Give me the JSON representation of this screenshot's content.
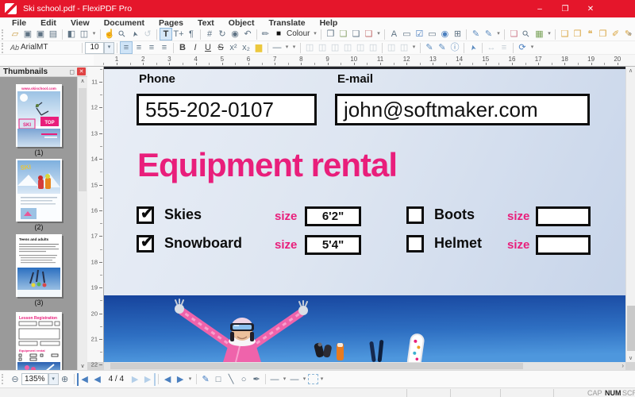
{
  "window": {
    "title": "Ski school.pdf - FlexiPDF Pro",
    "minimize": "–",
    "maximize": "❐",
    "close": "✕"
  },
  "menu": [
    "File",
    "Edit",
    "View",
    "Document",
    "Pages",
    "Text",
    "Object",
    "Translate",
    "Help"
  ],
  "strips": {
    "main": [
      [
        {
          "name": "open-file-icon",
          "glyph": "▱",
          "cls": "c-folder"
        },
        {
          "name": "save-icon",
          "glyph": "▣"
        },
        {
          "name": "save-as-icon",
          "glyph": "▣"
        },
        {
          "name": "print-icon",
          "glyph": "▤"
        }
      ],
      [
        {
          "name": "single-page-view-icon",
          "glyph": "◧"
        },
        {
          "name": "facing-pages-view-icon",
          "glyph": "◫"
        },
        {
          "name": "view-menu-caret",
          "glyph": "▾",
          "cls": "caret"
        }
      ],
      [
        {
          "name": "hand-tool-icon",
          "glyph": "☝"
        },
        {
          "name": "zoom-tool-icon",
          "glyph": "⚲",
          "cls": "rot"
        },
        {
          "name": "select-tool-icon",
          "glyph": "➤",
          "cls": "rot2"
        },
        {
          "name": "rotate-view-icon",
          "glyph": "↺",
          "cls": "c-dis"
        }
      ],
      [
        {
          "name": "edit-text-icon",
          "glyph": "T",
          "cls": "c-active"
        },
        {
          "name": "add-text-icon",
          "glyph": "T+"
        },
        {
          "name": "text-tool-icon",
          "glyph": "¶"
        }
      ],
      [
        {
          "name": "crop-icon",
          "glyph": "#"
        },
        {
          "name": "rotate-object-icon",
          "glyph": "↻"
        },
        {
          "name": "snapshot-icon",
          "glyph": "◉"
        },
        {
          "name": "revert-icon",
          "glyph": "↶"
        }
      ],
      [
        {
          "name": "eyedropper-icon",
          "glyph": "✎",
          "cls": "rot"
        },
        {
          "name": "colour-swatch-icon",
          "glyph": "■",
          "cls": "c-black"
        },
        {
          "name": "colour-label",
          "text": "Colour",
          "cls": "lbl",
          "ro": true
        },
        {
          "name": "colour-caret",
          "glyph": "▾",
          "cls": "caret"
        }
      ],
      [
        {
          "name": "extract-page-icon",
          "glyph": "❐"
        },
        {
          "name": "insert-page-icon",
          "glyph": "❏",
          "cls": "c-plus"
        },
        {
          "name": "edit-page-icon",
          "glyph": "❏"
        },
        {
          "name": "delete-page-icon",
          "glyph": "❏",
          "cls": "c-del"
        },
        {
          "name": "pages-caret",
          "glyph": "▾",
          "cls": "caret"
        }
      ],
      [
        {
          "name": "form-text-field-icon",
          "glyph": "A"
        },
        {
          "name": "form-button-icon",
          "glyph": "▭"
        },
        {
          "name": "form-checkbox-icon",
          "glyph": "☑",
          "cls": "c-blue"
        },
        {
          "name": "form-field-icon",
          "glyph": "▭"
        },
        {
          "name": "form-radio-icon",
          "glyph": "◉",
          "cls": "c-blue"
        },
        {
          "name": "form-combo-icon",
          "glyph": "⊞"
        }
      ],
      [
        {
          "name": "edit-form-icon",
          "glyph": "✎",
          "cls": "c-blue2"
        },
        {
          "name": "form-properties-icon",
          "glyph": "✎",
          "cls": "c-blue2"
        },
        {
          "name": "form-caret",
          "glyph": "▾",
          "cls": "caret"
        }
      ],
      [
        {
          "name": "preflight-icon",
          "glyph": "❏",
          "cls": "c-pink"
        },
        {
          "name": "find-icon",
          "glyph": "⚲",
          "cls": "rot"
        },
        {
          "name": "insert-image-icon",
          "glyph": "▦",
          "cls": "c-img"
        },
        {
          "name": "media-caret",
          "glyph": "▾",
          "cls": "caret"
        }
      ],
      [
        {
          "name": "note-icon",
          "glyph": "❑",
          "cls": "c-note"
        },
        {
          "name": "text-note-icon",
          "glyph": "❒",
          "cls": "c-note"
        },
        {
          "name": "comment-icon",
          "glyph": "❝",
          "cls": "c-note"
        },
        {
          "name": "stamp-icon",
          "glyph": "❐",
          "cls": "c-note"
        },
        {
          "name": "highlight-note-icon",
          "glyph": "✐",
          "cls": "c-note"
        },
        {
          "name": "strike-note-icon",
          "glyph": "✎",
          "cls": "c-note"
        }
      ]
    ],
    "format": [
      [
        {
          "name": "font-style-icon",
          "glyph": "Ab",
          "cls": "ab"
        },
        {
          "name": "font-name-value",
          "text": "ArialMT",
          "cls": "fname"
        }
      ],
      [
        {
          "name": "font-size-value",
          "text": "10",
          "cls": "box"
        },
        {
          "name": "font-size-caret",
          "glyph": "▾",
          "cls": "caretbox"
        }
      ],
      [
        {
          "name": "align-left-icon",
          "glyph": "≡",
          "cls": "c-sel"
        },
        {
          "name": "align-center-icon",
          "glyph": "≡"
        },
        {
          "name": "align-right-icon",
          "glyph": "≡"
        },
        {
          "name": "align-justify-icon",
          "glyph": "≡"
        }
      ],
      [
        {
          "name": "bold-icon",
          "glyph": "B",
          "cls": "bold"
        },
        {
          "name": "italic-icon",
          "glyph": "I",
          "cls": "ital"
        },
        {
          "name": "underline-icon",
          "glyph": "U",
          "cls": "und"
        },
        {
          "name": "strikethrough-icon",
          "glyph": "S",
          "cls": "strk"
        },
        {
          "name": "superscript-icon",
          "glyph": "x²"
        },
        {
          "name": "subscript-icon",
          "glyph": "x₂"
        },
        {
          "name": "highlight-colour-icon",
          "glyph": "▆",
          "cls": "c-hl"
        }
      ],
      [
        {
          "name": "line-style-icon",
          "glyph": "—"
        },
        {
          "name": "line-style-caret",
          "glyph": "▾",
          "cls": "caret"
        },
        {
          "name": "more-format-caret",
          "glyph": "▾",
          "cls": "caret"
        }
      ],
      [
        {
          "name": "align-objects-left-icon",
          "glyph": "◫",
          "cls": "c-dis"
        },
        {
          "name": "align-objects-center-icon",
          "glyph": "◫",
          "cls": "c-dis"
        },
        {
          "name": "align-objects-right-icon",
          "glyph": "◫",
          "cls": "c-dis"
        },
        {
          "name": "align-objects-top-icon",
          "glyph": "◫",
          "cls": "c-dis"
        },
        {
          "name": "align-objects-middle-icon",
          "glyph": "◫",
          "cls": "c-dis"
        },
        {
          "name": "align-objects-bottom-icon",
          "glyph": "◫",
          "cls": "c-dis"
        }
      ],
      [
        {
          "name": "distribute-h-icon",
          "glyph": "◫",
          "cls": "c-dis"
        },
        {
          "name": "distribute-v-icon",
          "glyph": "◫",
          "cls": "c-dis"
        },
        {
          "name": "arrange-caret",
          "glyph": "▾",
          "cls": "caret"
        }
      ],
      [
        {
          "name": "edit-object-icon",
          "glyph": "✎",
          "cls": "c-blue2"
        },
        {
          "name": "object-properties-icon",
          "glyph": "✎",
          "cls": "c-blue2"
        },
        {
          "name": "object-info-icon",
          "glyph": "ⓘ",
          "cls": "c-blue2"
        }
      ],
      [
        {
          "name": "pointer-icon",
          "glyph": "➤",
          "cls": "rot2 c-blue2"
        }
      ],
      [
        {
          "name": "flip-icon",
          "glyph": "↔",
          "cls": "c-dis"
        },
        {
          "name": "layers-icon",
          "glyph": "≡",
          "cls": "c-dis"
        }
      ],
      [
        {
          "name": "translate-sync-icon",
          "glyph": "⟳",
          "cls": "c-blue"
        },
        {
          "name": "translate-caret",
          "glyph": "▾",
          "cls": "caret"
        }
      ]
    ],
    "bottom": [
      [
        {
          "name": "zoom-out-icon",
          "glyph": "⊖"
        },
        {
          "name": "zoom-level-value",
          "text": "135%",
          "cls": "box"
        },
        {
          "name": "zoom-caret",
          "glyph": "▾",
          "cls": "caretbox"
        },
        {
          "name": "zoom-in-icon",
          "glyph": "⊕"
        }
      ],
      [
        {
          "name": "first-page-icon",
          "glyph": "◀",
          "cls": "c-blue barl"
        },
        {
          "name": "prev-page-icon",
          "glyph": "◀",
          "cls": "c-blue"
        },
        {
          "name": "page-indicator",
          "text": "4 / 4",
          "cls": "plabel",
          "ro": true
        },
        {
          "name": "next-page-icon",
          "glyph": "▶",
          "cls": "c-pale"
        },
        {
          "name": "last-page-icon",
          "glyph": "▶",
          "cls": "c-pale barr"
        }
      ],
      [
        {
          "name": "nav-back-icon",
          "glyph": "◀",
          "cls": "c-blue"
        },
        {
          "name": "nav-forward-icon",
          "glyph": "▶",
          "cls": "c-blue"
        },
        {
          "name": "nav-caret",
          "glyph": "▾",
          "cls": "caret"
        }
      ],
      [
        {
          "name": "pencil-tool-icon",
          "glyph": "✎",
          "cls": "c-pen"
        },
        {
          "name": "rectangle-tool-icon",
          "glyph": "□"
        },
        {
          "name": "line-tool-icon",
          "glyph": "╲"
        },
        {
          "name": "ellipse-tool-icon",
          "glyph": "○"
        },
        {
          "name": "pen-tool-icon",
          "glyph": "✒"
        }
      ],
      [
        {
          "name": "stroke-style-icon",
          "glyph": "—"
        },
        {
          "name": "stroke-style-caret",
          "glyph": "▾",
          "cls": "caret"
        },
        {
          "name": "stroke-width-icon",
          "glyph": "—"
        },
        {
          "name": "stroke-width-caret",
          "glyph": "▾",
          "cls": "caret"
        },
        {
          "name": "select-frame-icon",
          "glyph": "",
          "cls": "dashed"
        },
        {
          "name": "draw-tools-caret",
          "glyph": "▾",
          "cls": "caret"
        }
      ]
    ]
  },
  "toolbar_overflow": "»",
  "rulers": {
    "horizontal": [
      "1",
      "2",
      "3",
      "4",
      "5",
      "6",
      "7",
      "8",
      "9",
      "10",
      "11",
      "12",
      "13",
      "14",
      "15",
      "16",
      "17",
      "18",
      "19",
      "20"
    ],
    "vertical": [
      "11",
      "12",
      "13",
      "14",
      "15",
      "16",
      "17",
      "18",
      "19",
      "20",
      "21",
      "22"
    ]
  },
  "thumbnails": {
    "panel_title": "Thumbnails",
    "page1_label": "(1)",
    "page2_label": "(2)",
    "page3_label": "(3)",
    "page1_texts": {
      "url": "www.skischool.com",
      "badge": "TOP",
      "ski": "SKI"
    },
    "page2_texts": {
      "ski": "SKI"
    },
    "page3_texts": {
      "title": "Teens and adults"
    },
    "page4_texts": {
      "title": "Lesson  Registration",
      "heading": "Equipment rental"
    }
  },
  "document": {
    "phone_label": "Phone",
    "phone_value": "555-202-0107",
    "email_label": "E-mail",
    "email_value": "john@softmaker.com",
    "heading": "Equipment rental",
    "fields": [
      {
        "label": "Skies",
        "checked": true,
        "size_label": "size",
        "size_value": "6'2\""
      },
      {
        "label": "Boots",
        "checked": false,
        "size_label": "size",
        "size_value": ""
      },
      {
        "label": "Snowboard",
        "checked": true,
        "size_label": "size",
        "size_value": "5'4\""
      },
      {
        "label": "Helmet",
        "checked": false,
        "size_label": "size",
        "size_value": ""
      }
    ]
  },
  "scrollbars": {
    "up": "∧",
    "down": "∨",
    "right": "›"
  },
  "status": {
    "cap_label": "CAP",
    "num_label": "NUM",
    "scrl_label": "SCRL"
  }
}
